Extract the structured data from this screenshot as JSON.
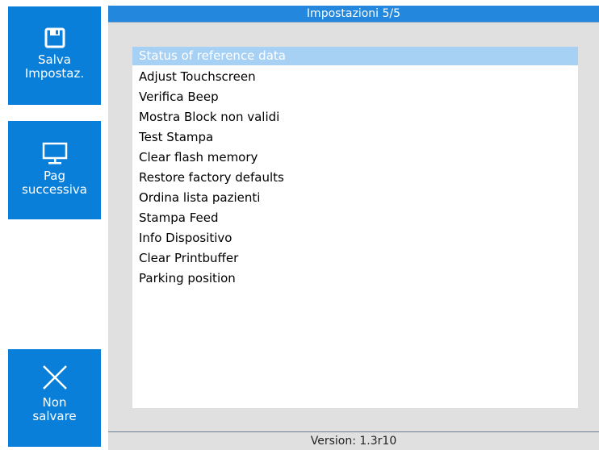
{
  "sidebar": {
    "save": {
      "label": "Salva\nImpostaz.",
      "icon": "floppy-disk-icon"
    },
    "next": {
      "label": "Pag\nsuccessiva",
      "icon": "monitor-icon"
    },
    "cancel": {
      "label": "Non\nsalvare",
      "icon": "close-icon"
    }
  },
  "panel": {
    "title": "Impostazioni 5/5",
    "items": [
      "Status of reference data",
      "Adjust Touchscreen",
      "Verifica Beep",
      "Mostra Block non validi",
      "Test Stampa",
      "Clear flash memory",
      "Restore factory defaults",
      "Ordina lista pazienti",
      "Stampa Feed",
      "Info Dispositivo",
      "Clear Printbuffer",
      "Parking position"
    ],
    "selected_index": 0,
    "footer": "Version: 1.3r10"
  },
  "colors": {
    "button_blue": "#0a7fd9",
    "title_blue": "#2387dd",
    "selection": "#a7d0f5",
    "panel_bg": "#e0e0e0"
  }
}
